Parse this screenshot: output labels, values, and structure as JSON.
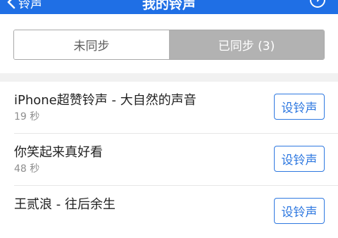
{
  "nav": {
    "title": "我的铃声",
    "back_label": "铃声",
    "help_icon": "question-circle-icon"
  },
  "tabs": [
    {
      "label": "未同步",
      "selected": false
    },
    {
      "label": "已同步 (3)",
      "selected": true
    }
  ],
  "ringtones": [
    {
      "name": "iPhone超赞铃声 - 大自然的声音",
      "duration": "19 秒",
      "action": "设铃声"
    },
    {
      "name": "你笑起来真好看",
      "duration": "48 秒",
      "action": "设铃声"
    },
    {
      "name": "王贰浪 - 往后余生",
      "duration": "",
      "action": "设铃声"
    }
  ],
  "colors": {
    "nav_bg": "#1f6fe5",
    "accent": "#2e78e0",
    "tab_active_bg": "#b2b2b2",
    "list_gap": "#f1f1f1"
  }
}
